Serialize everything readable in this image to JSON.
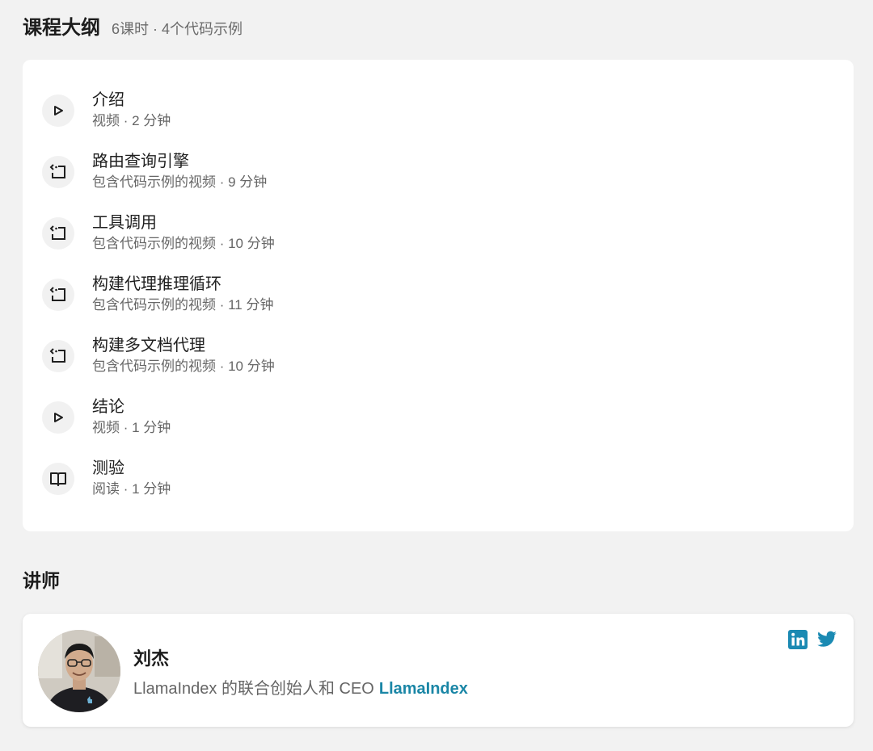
{
  "outline": {
    "title": "课程大纲",
    "summary": "6课时 · 4个代码示例",
    "lessons": [
      {
        "icon": "play-icon",
        "title": "介绍",
        "meta": "视频 · 2 分钟"
      },
      {
        "icon": "code-icon",
        "title": "路由查询引擎",
        "meta": "包含代码示例的视频 · 9 分钟"
      },
      {
        "icon": "code-icon",
        "title": "工具调用",
        "meta": "包含代码示例的视频 · 10 分钟"
      },
      {
        "icon": "code-icon",
        "title": "构建代理推理循环",
        "meta": "包含代码示例的视频 · 11 分钟"
      },
      {
        "icon": "code-icon",
        "title": "构建多文档代理",
        "meta": "包含代码示例的视频 · 10 分钟"
      },
      {
        "icon": "play-icon",
        "title": "结论",
        "meta": "视频 · 1 分钟"
      },
      {
        "icon": "book-icon",
        "title": "测验",
        "meta": "阅读 · 1 分钟"
      }
    ]
  },
  "instructors": {
    "title": "讲师",
    "name": "刘杰",
    "role": "LlamaIndex 的联合创始人和 CEO",
    "company": "LlamaIndex",
    "social": [
      "linkedin-icon",
      "twitter-icon"
    ]
  },
  "colors": {
    "accent": "#1a86a6",
    "social": "#1b8ab3"
  }
}
